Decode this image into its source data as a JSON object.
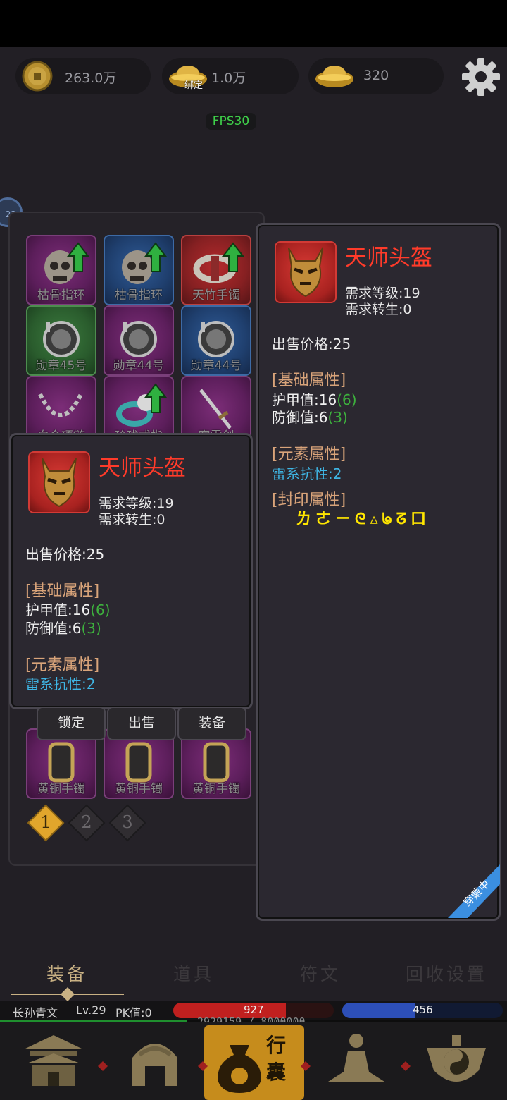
{
  "currency": {
    "copper": "263.0万",
    "bound_gold_badge": "绑定",
    "bound_gold": "1.0万",
    "gold": "320"
  },
  "fps": "FPS30",
  "side_badge": "22",
  "bag": {
    "items": [
      {
        "label": "枯骨指环",
        "rarity": "purple",
        "upgrade": true
      },
      {
        "label": "枯骨指环",
        "rarity": "blue",
        "upgrade": true
      },
      {
        "label": "天竹手镯",
        "rarity": "red",
        "upgrade": true
      },
      {
        "label": "勋章45号",
        "rarity": "green",
        "upgrade": false
      },
      {
        "label": "勋章44号",
        "rarity": "purple",
        "upgrade": false
      },
      {
        "label": "勋章44号",
        "rarity": "blue",
        "upgrade": false
      },
      {
        "label": "白金项链",
        "rarity": "purple",
        "upgrade": false
      },
      {
        "label": "玲珑戒指",
        "rarity": "purple",
        "upgrade": true
      },
      {
        "label": "寒霜剑",
        "rarity": "purple",
        "upgrade": false
      },
      {
        "label": "黄铜手镯",
        "rarity": "purple",
        "upgrade": false
      },
      {
        "label": "黄铜手镯",
        "rarity": "purple",
        "upgrade": false
      },
      {
        "label": "黄铜手镯",
        "rarity": "purple",
        "upgrade": false
      }
    ],
    "pages": [
      "1",
      "2",
      "3"
    ],
    "active_page": "1"
  },
  "selected_item": {
    "name": "天师头盔",
    "req_level": "需求等级:19",
    "req_rebirth": "需求转生:0",
    "price": "出售价格:25",
    "base_title": "[基础属性]",
    "armor": "护甲值:16",
    "armor_bonus": "(6)",
    "defense": "防御值:6",
    "defense_bonus": "(3)",
    "element_title": "[元素属性]",
    "thunder": "雷系抗性:2",
    "actions": {
      "lock": "锁定",
      "sell": "出售",
      "equip": "装备"
    }
  },
  "equipped_item": {
    "name": "天师头盔",
    "req_level": "需求等级:19",
    "req_rebirth": "需求转生:0",
    "price": "出售价格:25",
    "base_title": "[基础属性]",
    "armor": "护甲值:16",
    "armor_bonus": "(6)",
    "defense": "防御值:6",
    "defense_bonus": "(3)",
    "element_title": "[元素属性]",
    "thunder": "雷系抗性:2",
    "seal_title": "[封印属性]",
    "seal_runes": "ㄌㄜㄧᘓ▵ᖚᘔ口",
    "ribbon": "穿戴中"
  },
  "tabs": [
    {
      "label": "装备",
      "active": true
    },
    {
      "label": "道具",
      "active": false
    },
    {
      "label": "符文",
      "active": false
    },
    {
      "label": "回收设置",
      "active": false
    }
  ],
  "status": {
    "name": "长孙青文",
    "level": "Lv.29",
    "pk": "PK值:0",
    "hp": "927",
    "hp_fraction": 0.7,
    "mp": "456",
    "mp_fraction": 0.45,
    "exp": "2929159 / 8000000"
  },
  "nav": [
    {
      "icon": "palace-icon"
    },
    {
      "icon": "helmet-icon"
    },
    {
      "icon": "bag-icon",
      "label": "行囊",
      "active": true
    },
    {
      "icon": "meditation-icon"
    },
    {
      "icon": "taiji-icon"
    }
  ],
  "colors": {
    "hp": "#c0201f",
    "mp": "#2d4fb8",
    "exp": "#1f8f2e",
    "name_red": "#ff3b2a",
    "section": "#d9a47a",
    "bonus": "#3db13d",
    "element": "#3fb6e5",
    "seal": "#ffe600"
  }
}
